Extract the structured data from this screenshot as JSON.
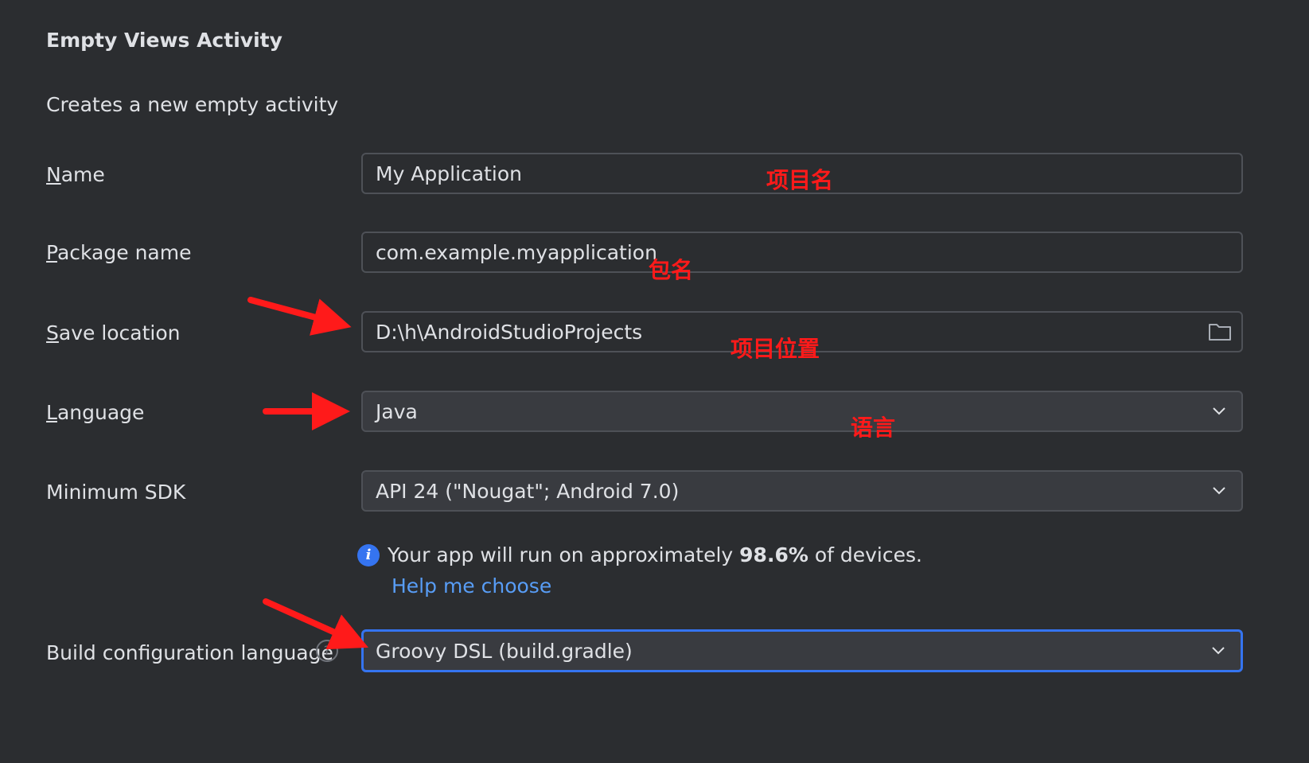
{
  "header": {
    "title": "Empty Views Activity",
    "description": "Creates a new empty activity"
  },
  "form": {
    "name": {
      "label_mnemonic": "N",
      "label_rest": "ame",
      "value": "My Application"
    },
    "package": {
      "label_mnemonic": "P",
      "label_rest": "ackage name",
      "value": "com.example.myapplication"
    },
    "save_location": {
      "label_mnemonic": "S",
      "label_rest": "ave location",
      "value": "D:\\h\\AndroidStudioProjects",
      "icon": "folder-icon"
    },
    "language": {
      "label_mnemonic": "L",
      "label_rest": "anguage",
      "value": "Java"
    },
    "min_sdk": {
      "label": "Minimum SDK",
      "value": "API 24 (\"Nougat\"; Android 7.0)"
    },
    "info": {
      "prefix": "Your app will run on approximately ",
      "percent": "98.6%",
      "suffix": " of devices.",
      "help_link": "Help me choose"
    },
    "build_config": {
      "label": "Build configuration language",
      "value": "Groovy DSL (build.gradle)",
      "help_icon_glyph": "?"
    }
  },
  "annotations": {
    "name": "项目名",
    "package": "包名",
    "location": "项目位置",
    "language": "语言"
  },
  "colors": {
    "background": "#2b2d30",
    "accent": "#3574f0",
    "link": "#589df6",
    "annotation": "#ff1a1a"
  }
}
